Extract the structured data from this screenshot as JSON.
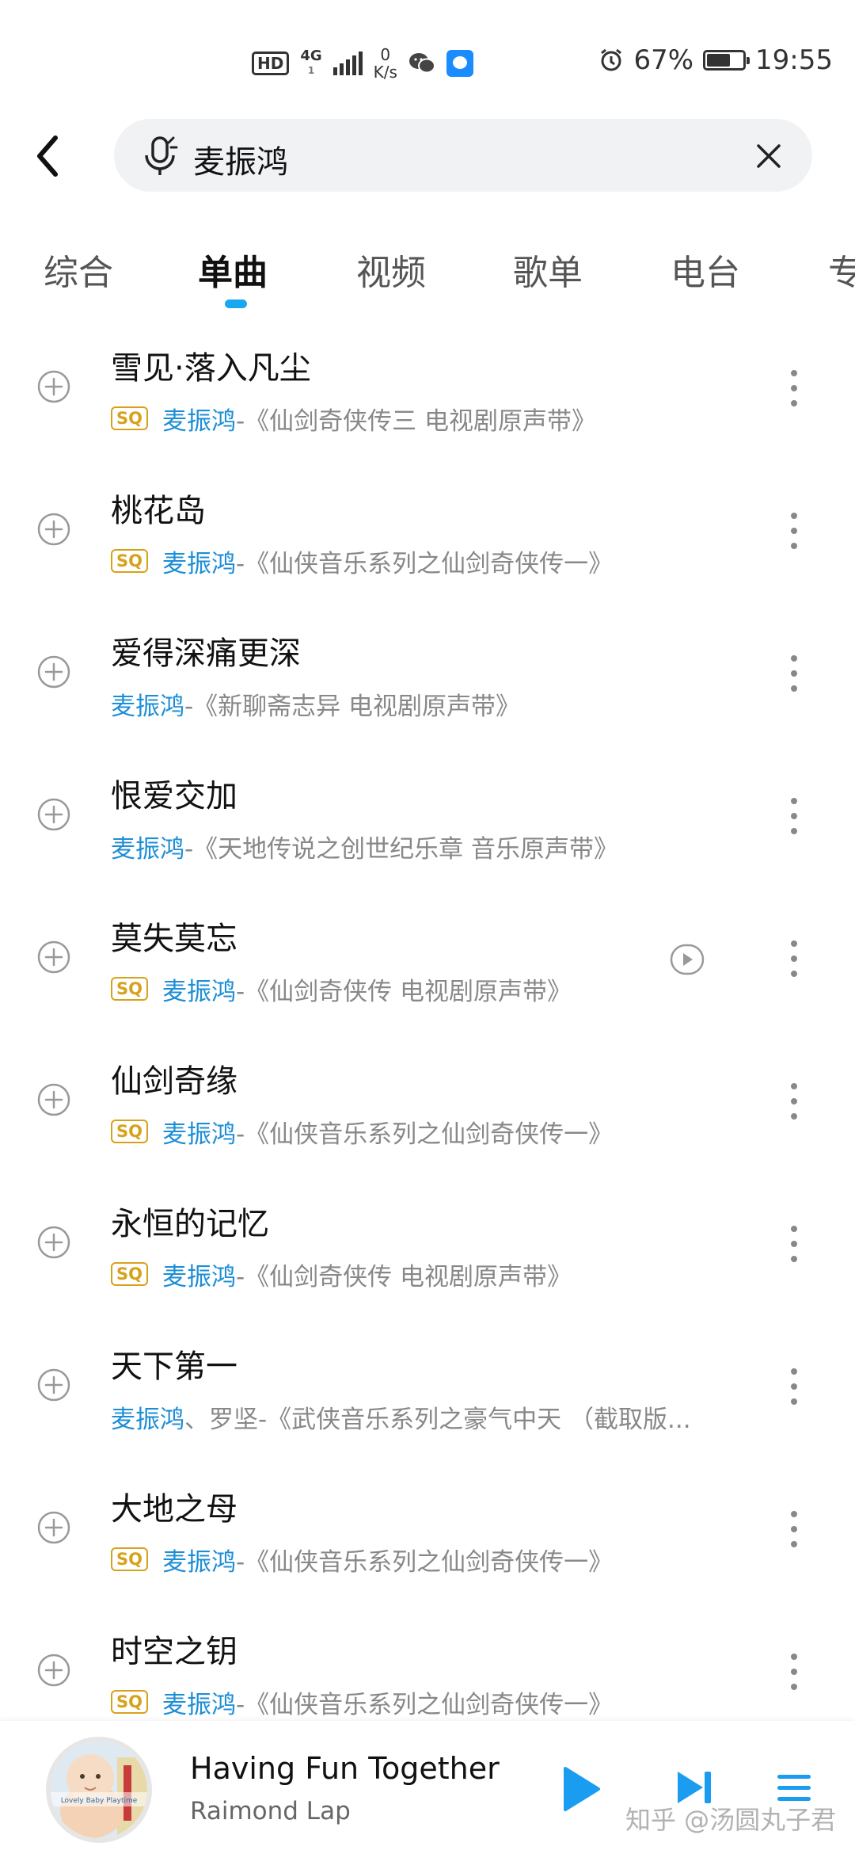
{
  "status_bar": {
    "hd": "HD",
    "network": "4G",
    "network_sub": "1",
    "speed_value": "0",
    "speed_unit": "K/s",
    "battery": "67%",
    "battery_level": 0.67,
    "time": "19:55"
  },
  "search": {
    "query": "麦振鸿"
  },
  "tabs": [
    "综合",
    "单曲",
    "视频",
    "歌单",
    "电台",
    "专"
  ],
  "active_tab": "单曲",
  "songs": [
    {
      "title": "雪见·落入凡尘",
      "sq": "SQ",
      "artist": "麦振鸿",
      "other_artists": "",
      "album": " -《仙剑奇侠传三 电视剧原声带》",
      "mv": false
    },
    {
      "title": "桃花岛",
      "sq": "SQ",
      "artist": "麦振鸿",
      "other_artists": "",
      "album": " -《仙侠音乐系列之仙剑奇侠传一》",
      "mv": false
    },
    {
      "title": "爱得深痛更深",
      "sq": "",
      "artist": "麦振鸿",
      "other_artists": "",
      "album": " -《新聊斋志异 电视剧原声带》",
      "mv": false
    },
    {
      "title": "恨爱交加",
      "sq": "",
      "artist": "麦振鸿",
      "other_artists": "",
      "album": " -《天地传说之创世纪乐章 音乐原声带》",
      "mv": false
    },
    {
      "title": "莫失莫忘",
      "sq": "SQ",
      "artist": "麦振鸿",
      "other_artists": "",
      "album": " -《仙剑奇侠传 电视剧原声带》",
      "mv": true
    },
    {
      "title": "仙剑奇缘",
      "sq": "SQ",
      "artist": "麦振鸿",
      "other_artists": "",
      "album": " -《仙侠音乐系列之仙剑奇侠传一》",
      "mv": false
    },
    {
      "title": "永恒的记忆",
      "sq": "SQ",
      "artist": "麦振鸿",
      "other_artists": "",
      "album": " -《仙剑奇侠传 电视剧原声带》",
      "mv": false
    },
    {
      "title": "天下第一",
      "sq": "",
      "artist": "麦振鸿",
      "other_artists": "、罗坚",
      "album": " -《武侠音乐系列之豪气中天 （截取版...",
      "mv": false
    },
    {
      "title": "大地之母",
      "sq": "SQ",
      "artist": "麦振鸿",
      "other_artists": "",
      "album": " -《仙侠音乐系列之仙剑奇侠传一》",
      "mv": false
    },
    {
      "title": "时空之钥",
      "sq": "SQ",
      "artist": "麦振鸿",
      "other_artists": "",
      "album": " -《仙侠音乐系列之仙剑奇侠传一》",
      "mv": false
    }
  ],
  "player": {
    "title": "Having Fun Together",
    "artist": "Raimond Lap",
    "cover_text": "Lovely Baby Playtime"
  },
  "watermark": "知乎 @汤圆丸子君",
  "colors": {
    "accent": "#19a7f0",
    "artist": "#1d8ed6",
    "sq_badge": "#d7a21b",
    "play_button": "#1a9cf0"
  },
  "icons": {
    "back": "chevron-left-icon",
    "mic": "mic-icon",
    "clear": "close-icon",
    "add": "plus-circle-icon",
    "more": "more-vertical-icon",
    "mv": "play-circle-icon",
    "play": "play-icon",
    "next": "skip-next-icon",
    "queue": "playlist-icon"
  }
}
